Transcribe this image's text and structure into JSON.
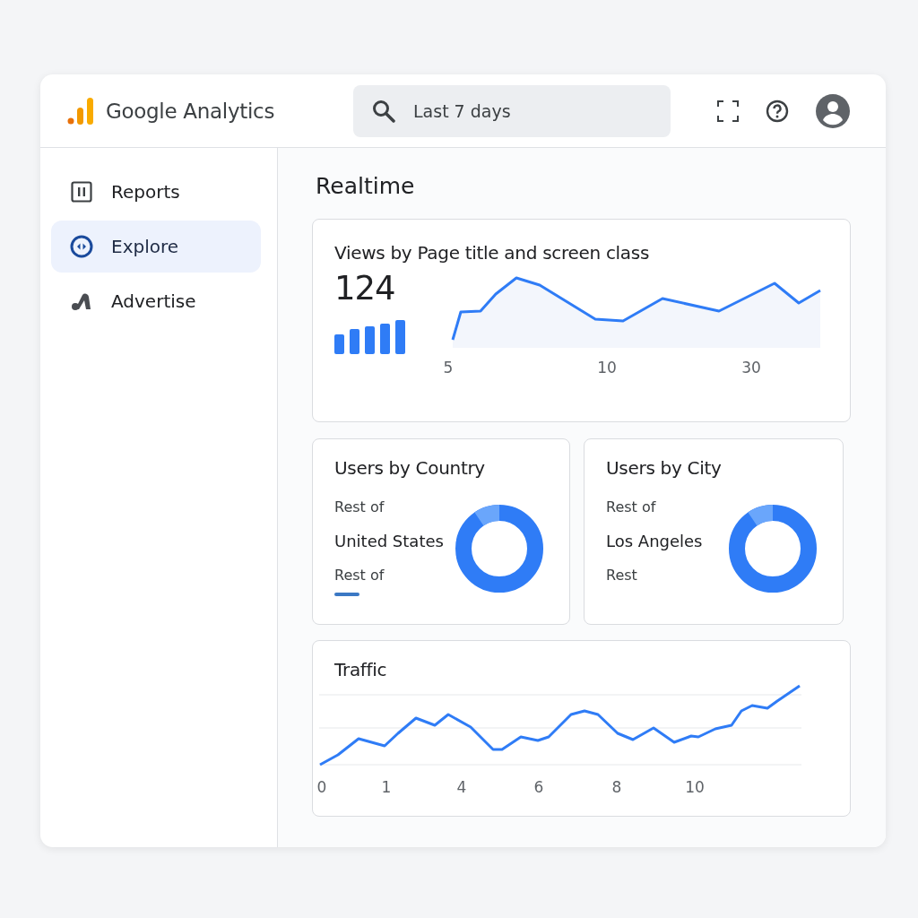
{
  "header": {
    "title": "Google Analytics",
    "search": {
      "value": "Last 7 days"
    }
  },
  "sidebar": {
    "items": [
      {
        "label": "Reports",
        "selected": false
      },
      {
        "label": "Explore",
        "selected": true
      },
      {
        "label": "Advertise",
        "selected": false
      }
    ]
  },
  "page_title": "Realtime",
  "views_card": {
    "title": "Views by Page title and screen class",
    "value": "124",
    "x_ticks": [
      "5",
      "10",
      "30"
    ]
  },
  "breakdown_cards": [
    {
      "title": "Users by Country",
      "legend_swatch": true,
      "legend": [
        {
          "kind": "label",
          "text": "Rest of"
        },
        {
          "kind": "value",
          "text": "United States"
        },
        {
          "kind": "label",
          "text": "Rest of"
        }
      ]
    },
    {
      "title": "Users by City",
      "legend_swatch": false,
      "legend": [
        {
          "kind": "label",
          "text": "Rest of"
        },
        {
          "kind": "value",
          "text": "Los Angeles"
        },
        {
          "kind": "label",
          "text": "Rest"
        }
      ]
    }
  ],
  "traffic_card": {
    "title": "Traffic",
    "x_ticks": [
      "0",
      "1",
      "4",
      "6",
      "8",
      "10"
    ]
  }
}
